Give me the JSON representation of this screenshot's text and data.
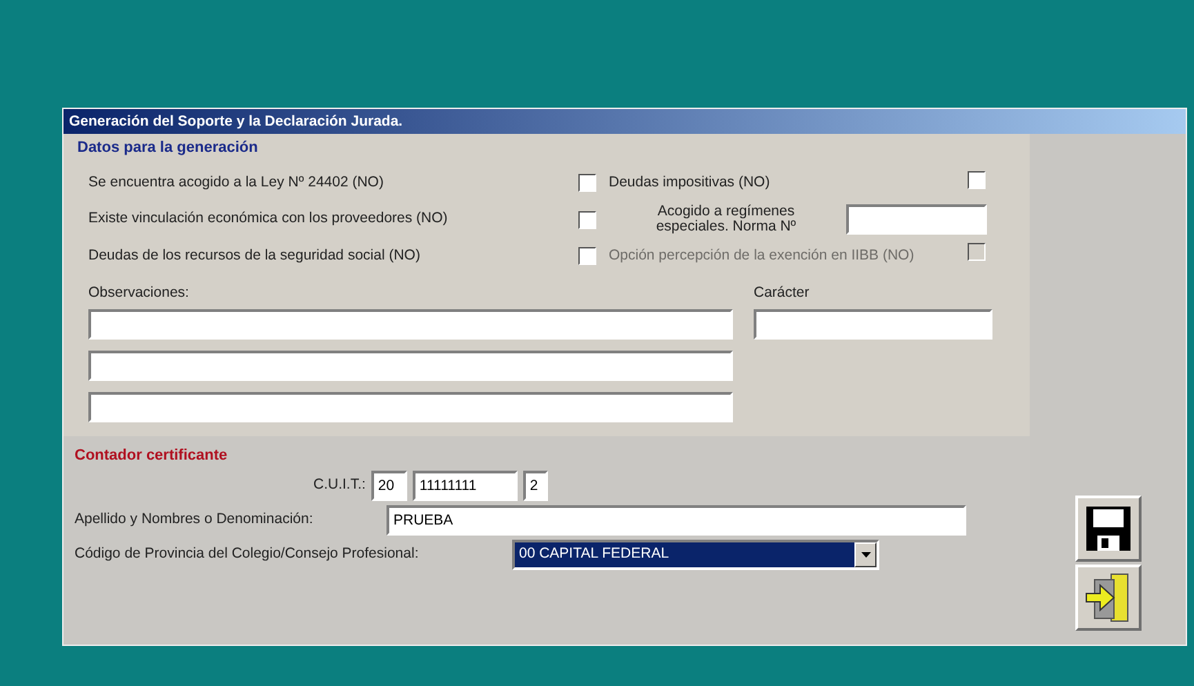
{
  "window": {
    "title": "Generación del Soporte y la Declaración Jurada."
  },
  "generation": {
    "heading": "Datos para la generación",
    "left_options": [
      {
        "label": "Se encuentra acogido a la Ley Nº 24402 (NO)",
        "checked": false,
        "disabled": false
      },
      {
        "label": "Existe vinculación económica con los proveedores (NO)",
        "checked": false,
        "disabled": false
      },
      {
        "label": "Deudas de los recursos de la seguridad social (NO)",
        "checked": false,
        "disabled": false
      }
    ],
    "right_items": [
      {
        "kind": "checkbox",
        "label": "Deudas impositivas (NO)",
        "checked": false,
        "disabled": false
      },
      {
        "kind": "field",
        "label": "Acogido a regímenes especiales. Norma Nº"
      },
      {
        "kind": "checkbox",
        "label": "Opción percepción de la exención en IIBB (NO)",
        "checked": false,
        "disabled": true
      }
    ],
    "observations": {
      "label": "Observaciones:",
      "lines": [
        {
          "kind": "text"
        },
        {
          "kind": "text"
        },
        {
          "kind": "text"
        }
      ]
    },
    "character": {
      "label": "Carácter"
    }
  },
  "accountant": {
    "heading": "Contador certificante",
    "cuit": {
      "label": "C.U.I.T.:",
      "parts": [
        "20",
        "11111111",
        "2"
      ]
    },
    "name": {
      "label": "Apellido y Nombres o Denominación:",
      "value": "PRUEBA"
    },
    "province": {
      "label": "Código de Provincia del Colegio/Consejo Profesional:",
      "value": "00 CAPITAL FEDERAL",
      "selected": true
    }
  },
  "buttons": [
    {
      "kind": "save"
    },
    {
      "kind": "exit"
    }
  ]
}
